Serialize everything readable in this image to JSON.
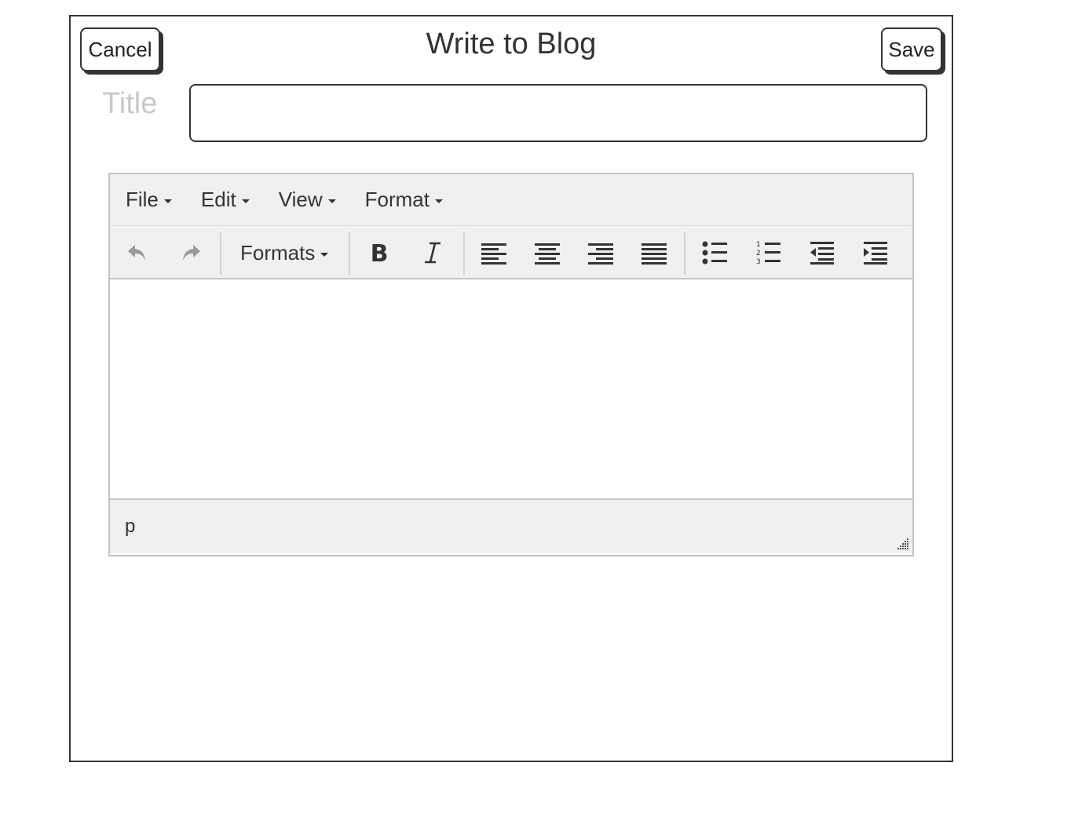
{
  "dialog": {
    "title": "Write to Blog",
    "cancel_label": "Cancel",
    "save_label": "Save"
  },
  "form": {
    "title_label": "Title",
    "title_value": "",
    "title_placeholder": ""
  },
  "editor": {
    "menubar": [
      {
        "label": "File"
      },
      {
        "label": "Edit"
      },
      {
        "label": "View"
      },
      {
        "label": "Format"
      }
    ],
    "toolbar": {
      "formats_label": "Formats",
      "buttons": [
        "undo-icon",
        "redo-icon",
        "bold-icon",
        "italic-icon",
        "align-left-icon",
        "align-center-icon",
        "align-right-icon",
        "align-justify-icon",
        "bullet-list-icon",
        "numbered-list-icon",
        "outdent-icon",
        "indent-icon"
      ]
    },
    "content": "",
    "status_path": "p"
  },
  "colors": {
    "border": "#333333",
    "editor_chrome": "#f0f0f0",
    "editor_border": "#c4c4c4",
    "label_placeholder": "#c9c9c9",
    "text": "#333333"
  }
}
